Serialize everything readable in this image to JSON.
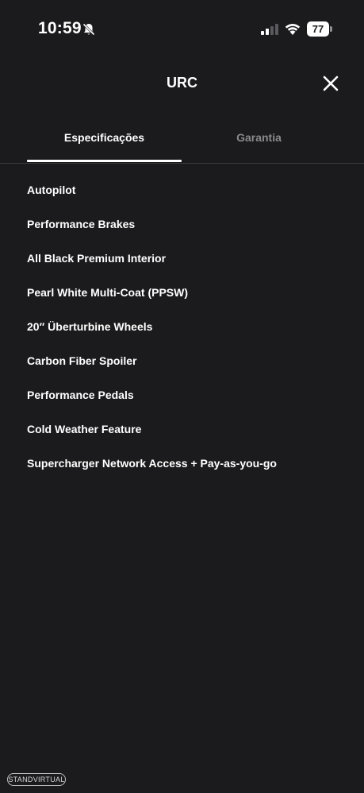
{
  "status_bar": {
    "time": "10:59",
    "battery": "77",
    "icons": [
      "bell-slash-icon",
      "cellular-signal-icon",
      "wifi-icon",
      "battery-icon"
    ]
  },
  "header": {
    "title": "URC",
    "close_icon": "close-icon"
  },
  "tabs": [
    {
      "label": "Especificações",
      "active": true
    },
    {
      "label": "Garantia",
      "active": false
    }
  ],
  "features": [
    "Autopilot",
    "Performance Brakes",
    "All Black Premium Interior",
    "Pearl White Multi-Coat (PPSW)",
    "20′′ Überturbine Wheels",
    "Carbon Fiber Spoiler",
    "Performance Pedals",
    "Cold Weather Feature",
    "Supercharger Network Access + Pay-as-you-go"
  ],
  "watermark": "STANDVIRTUAL",
  "colors": {
    "background": "#1b1b1d",
    "text": "#ffffff",
    "inactive_tab": "#8a8a8e",
    "divider": "#3a3a3d"
  }
}
